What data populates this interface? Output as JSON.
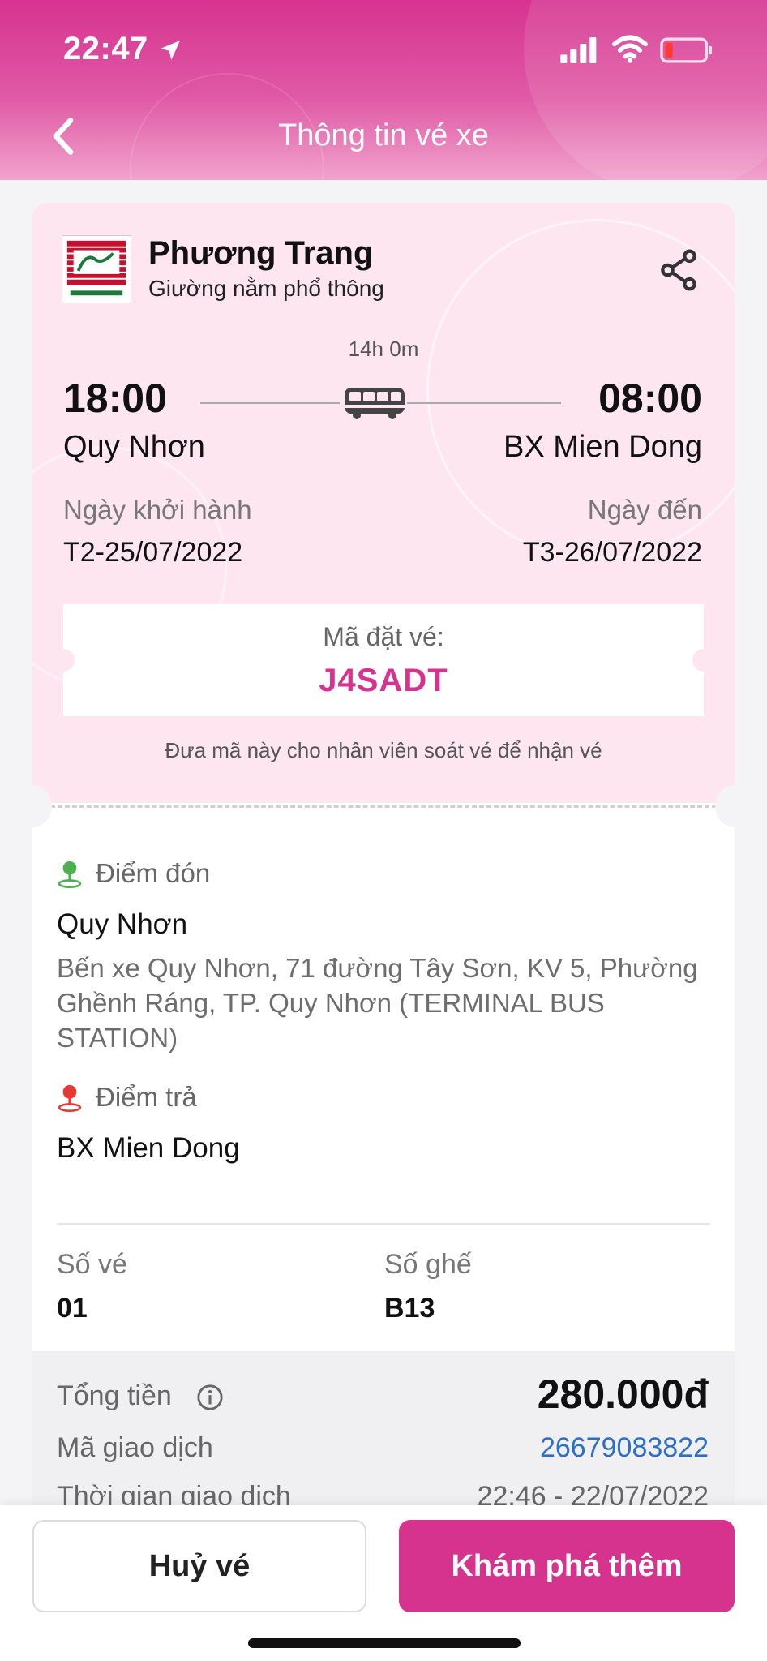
{
  "status_bar": {
    "time": "22:47"
  },
  "nav": {
    "title": "Thông tin vé xe"
  },
  "ticket": {
    "company": "Phương Trang",
    "bus_type": "Giường nằm phổ thông",
    "logo_text": "FUTA PHUONG TRANG",
    "duration": "14h 0m",
    "departure": {
      "time": "18:00",
      "place": "Quy Nhơn",
      "date_label": "Ngày khởi hành",
      "date": "T2-25/07/2022"
    },
    "arrival": {
      "time": "08:00",
      "place": "BX Mien Dong",
      "date_label": "Ngày đến",
      "date": "T3-26/07/2022"
    },
    "booking": {
      "label": "Mã đặt vé:",
      "code": "J4SADT",
      "hint": "Đưa mã này cho nhân viên soát vé để nhận vé"
    },
    "pickup": {
      "label": "Điểm đón",
      "name": "Quy Nhơn",
      "address": "Bến xe Quy Nhơn, 71 đường Tây Sơn, KV 5, Phường Ghềnh Ráng, TP. Quy Nhơn (TERMINAL BUS STATION)"
    },
    "dropoff": {
      "label": "Điểm trả",
      "name": "BX Mien Dong"
    },
    "ticket_count": {
      "label": "Số vé",
      "value": "01"
    },
    "seat": {
      "label": "Số ghế",
      "value": "B13"
    }
  },
  "payment": {
    "total_label": "Tổng tiền",
    "total_value": "280.000đ",
    "txn_label": "Mã giao dịch",
    "txn_value": "26679083822",
    "txn_time_label": "Thời gian giao dịch",
    "txn_time_value": "22:46 - 22/07/2022"
  },
  "actions": {
    "cancel": "Huỷ vé",
    "explore": "Khám phá thêm"
  },
  "colors": {
    "brand": "#d6338f",
    "pickup_icon": "#4caf50",
    "dropoff_icon": "#e53935",
    "link": "#2d6fc7"
  }
}
